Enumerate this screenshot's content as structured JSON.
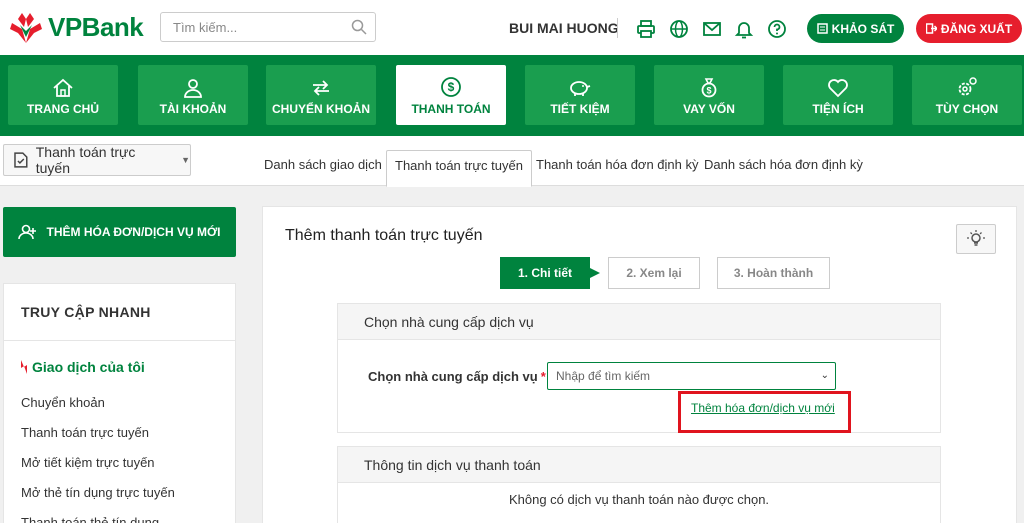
{
  "header": {
    "brand": "VPBank",
    "search_placeholder": "Tìm kiếm...",
    "username": "BUI MAI HUONG",
    "icons": [
      "printer-icon",
      "globe-icon",
      "mail-icon",
      "bell-icon",
      "help-icon"
    ],
    "survey_label": "KHẢO SÁT",
    "logout_label": "ĐĂNG XUẤT",
    "colors": {
      "brand_green": "#00833e",
      "danger_red": "#e61e2d"
    }
  },
  "nav": {
    "items": [
      {
        "label": "TRANG CHỦ",
        "icon": "home-icon",
        "active": false
      },
      {
        "label": "TÀI KHOẢN",
        "icon": "user-icon",
        "active": false
      },
      {
        "label": "CHUYỂN KHOẢN",
        "icon": "transfer-icon",
        "active": false
      },
      {
        "label": "THANH TOÁN",
        "icon": "dollar-icon",
        "active": true
      },
      {
        "label": "TIẾT KIỆM",
        "icon": "piggy-bank-icon",
        "active": false
      },
      {
        "label": "VAY VỐN",
        "icon": "money-bag-icon",
        "active": false
      },
      {
        "label": "TIỆN ÍCH",
        "icon": "heart-icon",
        "active": false
      },
      {
        "label": "TÙY CHỌN",
        "icon": "settings-icon",
        "active": false
      }
    ]
  },
  "subbar": {
    "selector_label": "Thanh toán trực tuyến",
    "tabs": [
      {
        "label": "Danh sách giao dịch",
        "active": false
      },
      {
        "label": "Thanh toán trực tuyến",
        "active": true
      },
      {
        "label": "Thanh toán hóa đơn định kỳ",
        "active": false
      },
      {
        "label": "Danh sách hóa đơn định kỳ",
        "active": false
      }
    ]
  },
  "sidebar": {
    "add_button_label": "THÊM HÓA ĐƠN/DỊCH VỤ MỚI",
    "quick_title": "TRUY CẬP NHANH",
    "quick_heading": "Giao dịch của tôi",
    "links": [
      "Chuyển khoản",
      "Thanh toán trực tuyến",
      "Mở tiết kiệm trực tuyến",
      "Mở thẻ tín dụng trực tuyến",
      "Thanh toán thẻ tín dụng"
    ]
  },
  "main": {
    "title": "Thêm thanh toán trực tuyến",
    "steps": [
      "1. Chi tiết",
      "2. Xem lại",
      "3. Hoàn thành"
    ],
    "provider_card": {
      "header": "Chọn nhà cung cấp dịch vụ",
      "field_label": "Chọn nhà cung cấp dịch vụ",
      "required_mark": "*",
      "select_placeholder": "Nhập để tìm kiếm",
      "add_link": "Thêm hóa đơn/dịch vụ mới"
    },
    "info_card": {
      "header": "Thông tin dịch vụ thanh toán",
      "empty_message": "Không có dịch vụ thanh toán nào được chọn."
    }
  }
}
